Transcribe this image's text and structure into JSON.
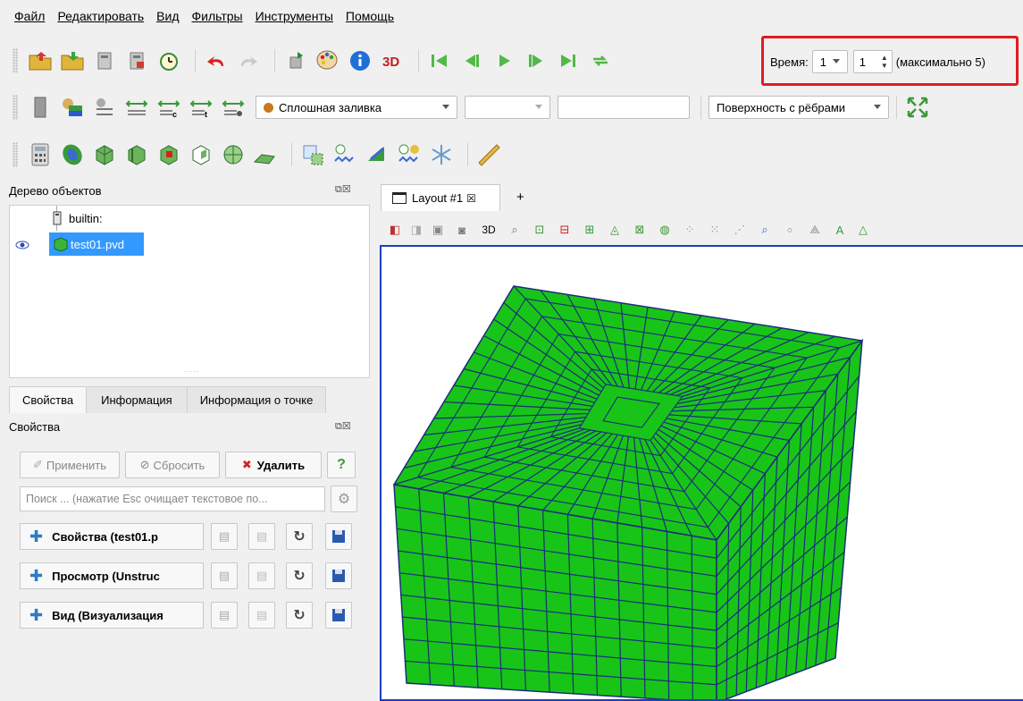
{
  "menu": [
    "Файл",
    "Редактировать",
    "Вид",
    "Фильтры",
    "Инструменты",
    "Помощь"
  ],
  "time": {
    "label": "Время:",
    "combo_value": "1",
    "spin_value": "1",
    "max_text": "(максимально 5)"
  },
  "toolbar2": {
    "coloring": "Сплошная заливка",
    "representation": "Поверхность с рёбрами"
  },
  "pipeline": {
    "title": "Дерево объектов",
    "root": "builtin:",
    "item": "test01.pvd"
  },
  "layout_tab": {
    "label": "Layout #1",
    "add": "+"
  },
  "view_toolbar": {
    "mode_3d": "3D"
  },
  "props_tabs": [
    "Свойства",
    "Информация",
    "Информация о точке"
  ],
  "props": {
    "title": "Свойства",
    "apply": "Применить",
    "reset": "Сбросить",
    "delete": "Удалить",
    "help": "?",
    "search_placeholder": "Поиск ... (нажатие Esc очищает текстовое по...",
    "sections": [
      "Свойства (test01.p",
      "Просмотр (Unstruc",
      "Вид (Визуализация"
    ]
  },
  "colors": {
    "mesh_fill": "#19c419",
    "mesh_edges": "#1a2d7a",
    "highlight": "#e11b22",
    "selection": "#3399ff",
    "view_border": "#1f3fbf"
  }
}
